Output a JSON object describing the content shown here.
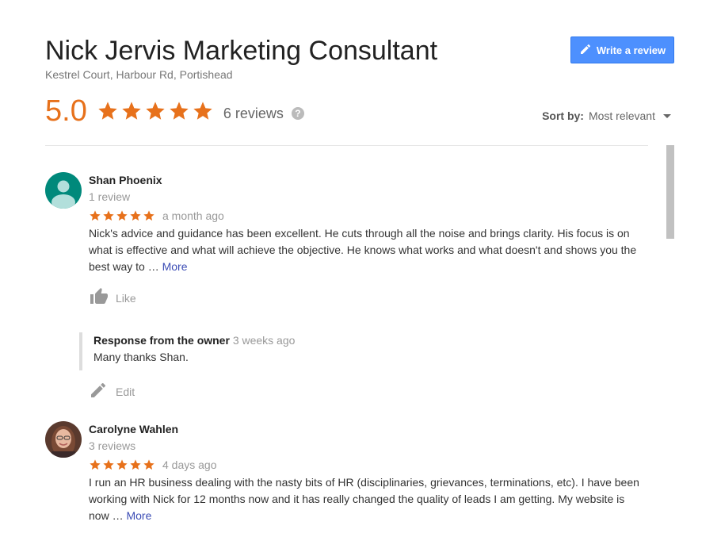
{
  "business": {
    "name": "Nick Jervis Marketing Consultant",
    "address": "Kestrel Court, Harbour Rd, Portishead"
  },
  "write_review_label": "Write a review",
  "rating": {
    "score": "5.0",
    "stars": 5,
    "reviews_label": "6 reviews",
    "star_color": "#e7711b"
  },
  "sort": {
    "label": "Sort by:",
    "value": "Most relevant"
  },
  "reviews": [
    {
      "name": "Shan Phoenix",
      "review_count": "1 review",
      "stars": 5,
      "time": "a month ago",
      "text": "Nick's advice and guidance has been excellent. He cuts through all the noise and brings clarity. His focus is on what is effective and what will achieve the objective. He knows what works and what doesn't and shows you the best way to …",
      "more_label": "More",
      "like_label": "Like",
      "owner_response": {
        "title": "Response from the owner",
        "time": "3 weeks ago",
        "text": "Many thanks Shan."
      },
      "edit_label": "Edit"
    },
    {
      "name": "Carolyne Wahlen",
      "review_count": "3 reviews",
      "stars": 5,
      "time": "4 days ago",
      "text": "I run an HR business dealing with the nasty bits of HR (disciplinaries, grievances, terminations, etc). I have been working with Nick for 12 months now and it has really changed the quality of leads I am getting. My website is now …",
      "more_label": "More"
    }
  ]
}
